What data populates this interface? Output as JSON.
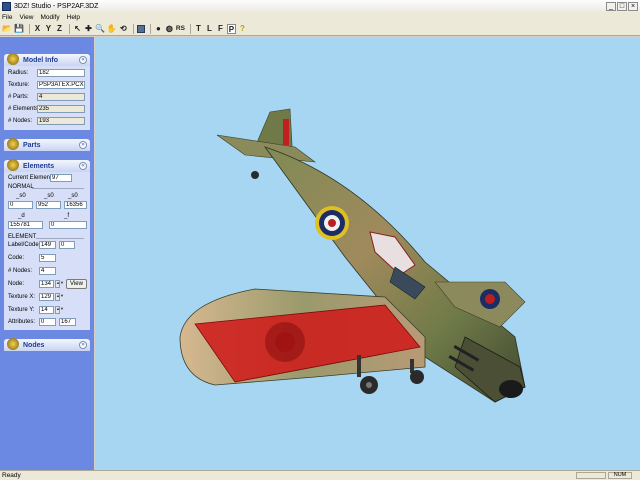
{
  "window": {
    "title": "3DZ! Studio - PSP2AF.3DZ"
  },
  "menu": [
    "File",
    "View",
    "Modify",
    "Help"
  ],
  "toolbar": {
    "x_label": "X",
    "y_label": "Y",
    "z_label": "Z",
    "rs_label": "RS",
    "t_label": "T",
    "l_label": "L",
    "f_label": "F",
    "p_label": "P"
  },
  "model_info": {
    "title": "Model Info",
    "radius_label": "Radius:",
    "radius": "182",
    "texture_label": "Texture:",
    "texture": "PSP3ATEX.PCX",
    "parts_label": "# Parts:",
    "parts": "4",
    "elements_label": "# Elements:",
    "elements": "235",
    "nodes_label": "# Nodes:",
    "nodes": "193"
  },
  "parts_panel": {
    "title": "Parts"
  },
  "elements_panel": {
    "title": "Elements",
    "current_label": "Current Element:",
    "current": "97",
    "normal_label": "NORMAL",
    "sx_label": "_s0",
    "sx": "0",
    "sy_label": "_s0",
    "sy": "952",
    "sz_label": "_s0",
    "sz": "16356",
    "d_label": "_d",
    "d": "155781",
    "f_label": "_f",
    "f": "0",
    "element_label": "ELEMENT",
    "labelcode_label": "Label/Code:",
    "labelcode1": "149",
    "labelcode2": "0",
    "code_label": "Code:",
    "code": "5",
    "nnodes_label": "# Nodes:",
    "nnodes": "4",
    "node_label": "Node:",
    "node": "134",
    "view_label": "View",
    "texx_label": "Texture X:",
    "texx": "129",
    "texy_label": "Texture Y:",
    "texy": "14",
    "attr_label": "Attributes:",
    "attr1": "0",
    "attr2": "167"
  },
  "nodes_panel": {
    "title": "Nodes"
  },
  "status": {
    "text": "Ready",
    "num": "NUM"
  },
  "colors": {
    "viewport_bg": "#a6d6f2",
    "sidebar_bg": "#6b89e3",
    "highlight": "#d01818"
  }
}
